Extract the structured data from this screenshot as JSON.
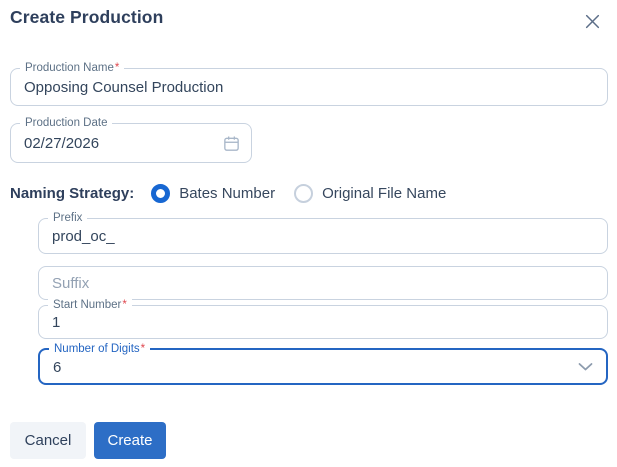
{
  "required_marker": "*",
  "dialog": {
    "title": "Create Production"
  },
  "fields": {
    "production_name": {
      "label": "Production Name",
      "required": true,
      "value": "Opposing Counsel Production"
    },
    "production_date": {
      "label": "Production Date",
      "required": false,
      "value": "02/27/2026"
    },
    "prefix": {
      "label": "Prefix",
      "required": false,
      "value": "prod_oc_"
    },
    "suffix": {
      "placeholder": "Suffix",
      "value": ""
    },
    "start_number": {
      "label": "Start Number",
      "required": true,
      "value": "1"
    },
    "number_of_digits": {
      "label": "Number of Digits",
      "required": true,
      "value": "6",
      "focused": true
    }
  },
  "naming_strategy": {
    "label": "Naming Strategy:",
    "options": [
      {
        "label": "Bates Number",
        "selected": true
      },
      {
        "label": "Original File Name",
        "selected": false
      }
    ]
  },
  "buttons": {
    "cancel": "Cancel",
    "create": "Create"
  },
  "icons": {
    "close": "x-cross",
    "calendar": "calendar-outline",
    "chevron_down": "chevron-down"
  },
  "colors": {
    "title_navy": "#2e3f5c",
    "field_border": "#c9d3e0",
    "focus_blue": "#2465c2",
    "radio_blue": "#1767d2",
    "create_button_blue": "#2d6ec6",
    "cancel_button_gray": "#f1f4f8",
    "required_red": "#e0484f",
    "label_slate": "#5d7186"
  }
}
